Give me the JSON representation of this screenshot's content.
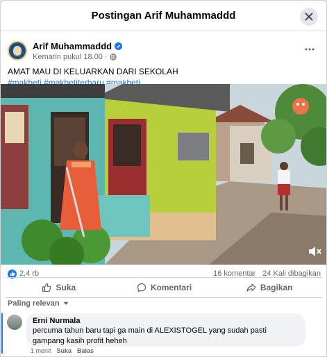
{
  "modal": {
    "title": "Postingan Arif Muhammaddd"
  },
  "post": {
    "author": "Arif Muhammaddd",
    "time": "Kemarin pukul 18.00",
    "time_separator": "·",
    "caption": "AMAT MAU DI KELUARKAN DARI SEKOLAH",
    "hashtags": [
      "#makbeti",
      "#makbetiterbaru",
      "#makbeti"
    ]
  },
  "stats": {
    "reactions": "2,4 rb",
    "comments": "16 komentar",
    "shares": "24 Kali dibagikan"
  },
  "actions": {
    "like": "Suka",
    "comment": "Komentari",
    "share": "Bagikan"
  },
  "sort": {
    "label": "Paling relevan"
  },
  "comment": {
    "author": "Erni Nurmala",
    "text": "percuma tahun baru tapi ga main di ALEXISTOGEL yang sudah pasti gampang kasih profit heheh",
    "time": "1 menit",
    "like": "Suka",
    "reply": "Balas"
  },
  "colors": {
    "accent": "#1877f2",
    "link": "#216fdb",
    "secondary_text": "#65676b"
  }
}
